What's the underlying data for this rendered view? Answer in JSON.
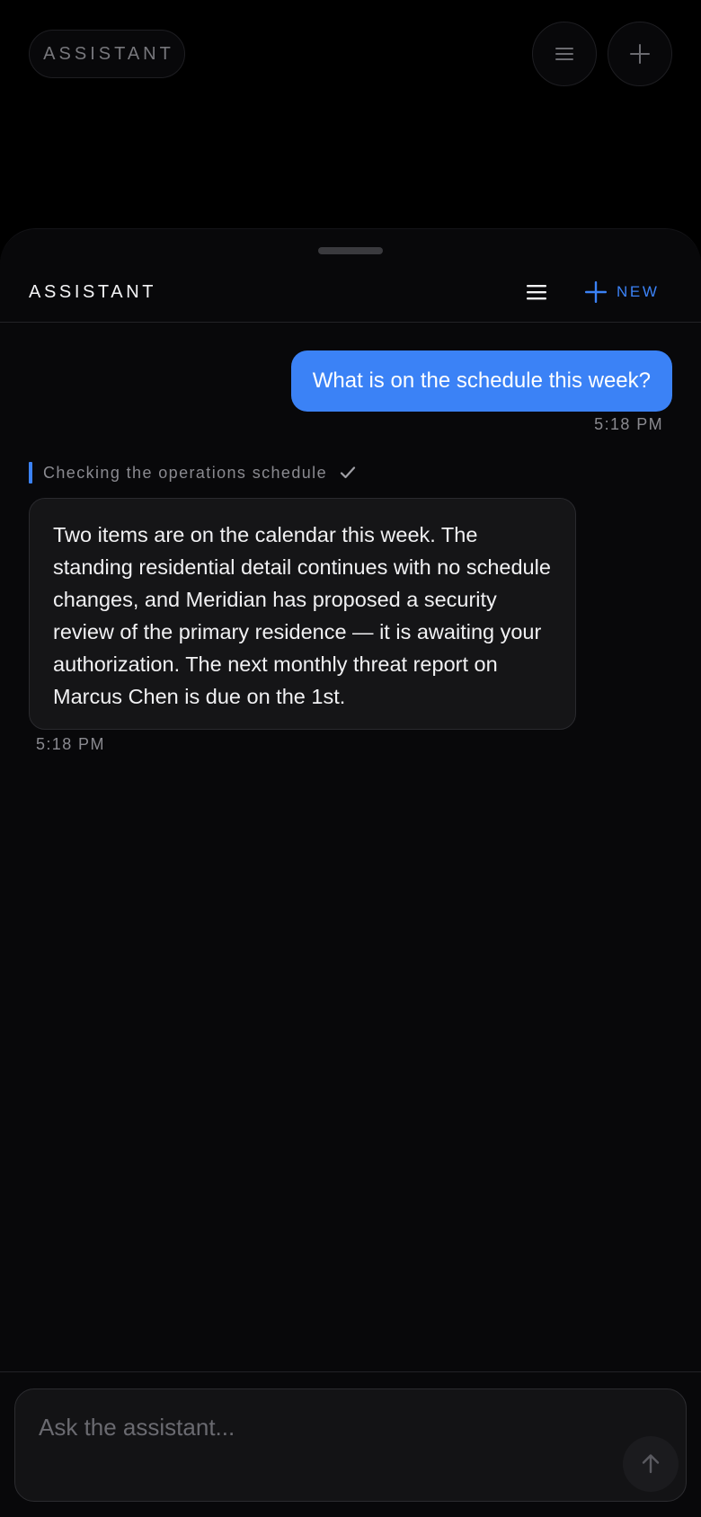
{
  "background_header": {
    "pill_label": "ASSISTANT",
    "menu_icon": "hamburger-icon",
    "plus_icon": "plus-icon"
  },
  "sheet": {
    "title": "ASSISTANT",
    "menu_icon": "hamburger-icon",
    "new_label": "NEW",
    "new_icon": "plus-icon"
  },
  "messages": [
    {
      "role": "user",
      "text": "What is on the schedule this week?",
      "time": "5:18 PM"
    },
    {
      "role": "assistant",
      "status": "Checking the operations schedule",
      "status_icon": "check-icon",
      "text": "Two items are on the calendar this week. The standing residential detail continues with no schedule changes, and Meridian has proposed a security review of the primary residence — it is awaiting your authorization. The next monthly threat report on Marcus Chen is due on the 1st.",
      "time": "5:18 PM"
    }
  ],
  "composer": {
    "value": "",
    "placeholder": "Ask the assistant...",
    "send_icon": "arrow-up-icon"
  },
  "colors": {
    "accent": "#3b82f6",
    "background": "#000000",
    "sheet": "#08080a",
    "bubble": "#151517",
    "muted_text": "#8a8a90"
  }
}
